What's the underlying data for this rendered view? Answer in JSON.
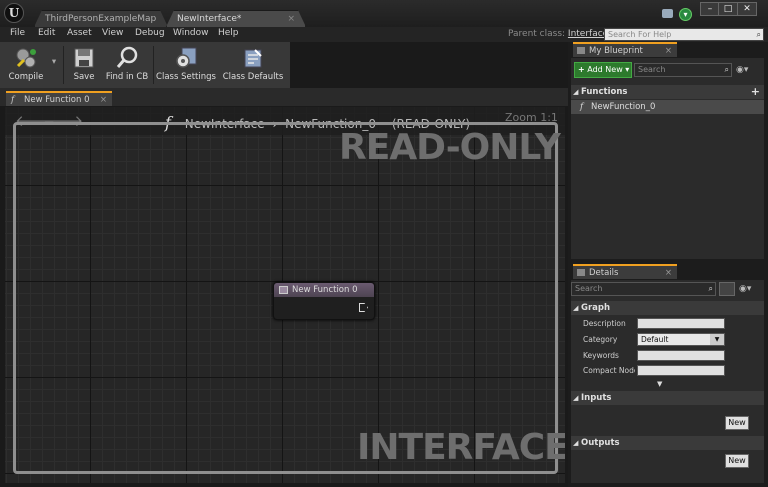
{
  "window": {
    "doc_tabs": [
      {
        "label": "ThirdPersonExampleMap"
      },
      {
        "label": "NewInterface*"
      }
    ],
    "buttons": {
      "minimize": "–",
      "maximize": "□",
      "close": "✕"
    }
  },
  "menu": {
    "items": [
      "File",
      "Edit",
      "Asset",
      "View",
      "Debug",
      "Window",
      "Help"
    ],
    "parent_class_label": "Parent class:",
    "parent_class_value": "Interface",
    "help_search_placeholder": "Search For Help"
  },
  "toolbar": {
    "compile": "Compile",
    "save": "Save",
    "find_in_cb": "Find in CB",
    "class_settings": "Class Settings",
    "class_defaults": "Class Defaults"
  },
  "graph": {
    "tab_label": "New Function 0",
    "breadcrumb_root": "NewInterface",
    "breadcrumb_leaf": "NewFunction_0",
    "breadcrumb_mode": "(READ-ONLY)",
    "zoom": "Zoom 1:1",
    "watermark_top": "READ-ONLY",
    "watermark_bottom": "INTERFACE",
    "node_title": "New Function 0"
  },
  "my_blueprint": {
    "tab_label": "My Blueprint",
    "add_new": "Add New",
    "search_placeholder": "Search",
    "functions_header": "Functions",
    "functions": [
      "NewFunction_0"
    ]
  },
  "details": {
    "tab_label": "Details",
    "search_placeholder": "Search",
    "graph_header": "Graph",
    "props": {
      "description": "Description",
      "category": "Category",
      "category_value": "Default",
      "keywords": "Keywords",
      "compact_node": "Compact Node"
    },
    "inputs_header": "Inputs",
    "outputs_header": "Outputs",
    "new_button": "New"
  },
  "colors": {
    "accent_tab": "#f0a020",
    "add_new_green": "#2d7a2d",
    "node_header": "#5a4e60"
  }
}
